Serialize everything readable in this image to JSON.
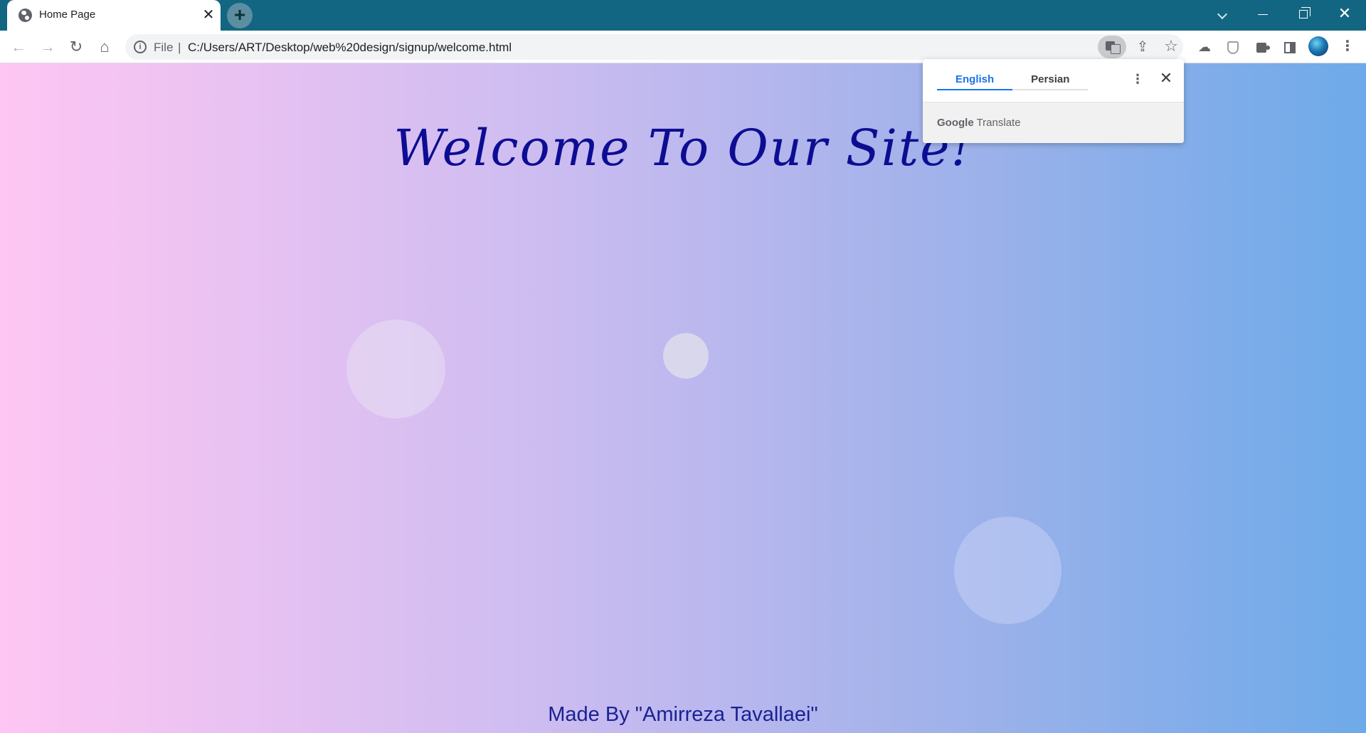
{
  "browser": {
    "tab": {
      "title": "Home Page",
      "close_symbol": "✕"
    },
    "new_tab_symbol": "+",
    "window_controls": {
      "close_symbol": "✕"
    },
    "toolbar": {
      "back_symbol": "←",
      "forward_symbol": "→",
      "reload_symbol": "↻",
      "home_symbol": "⌂",
      "menu_symbol": "⋮"
    },
    "omnibox": {
      "info_symbol": "i",
      "scheme_label": "File",
      "separator": "|",
      "url": "C:/Users/ART/Desktop/web%20design/signup/welcome.html",
      "share_symbol": "⇪",
      "bookmark_symbol": "☆"
    },
    "extensions": [
      {
        "name": "cloud-extension",
        "symbol": "☁"
      },
      {
        "name": "shield-extension"
      },
      {
        "name": "extensions-puzzle"
      },
      {
        "name": "side-panel"
      }
    ]
  },
  "page": {
    "heading": "Welcome To Our Site!",
    "credit": "Made By \"Amirreza Tavallaei\"",
    "background_gradient": [
      "#fec6f2",
      "#cfbdf1",
      "#a7b3eb",
      "#6eaae9"
    ],
    "heading_color": "#0d0d93"
  },
  "translate_popup": {
    "tabs": [
      {
        "label": "English",
        "active": true
      },
      {
        "label": "Persian",
        "active": false
      }
    ],
    "more_symbol": "⋮",
    "close_symbol": "✕",
    "brand_google": "Google",
    "brand_translate": "Translate"
  },
  "colors": {
    "tabstrip": "#136682",
    "accent": "#1a73e8"
  }
}
